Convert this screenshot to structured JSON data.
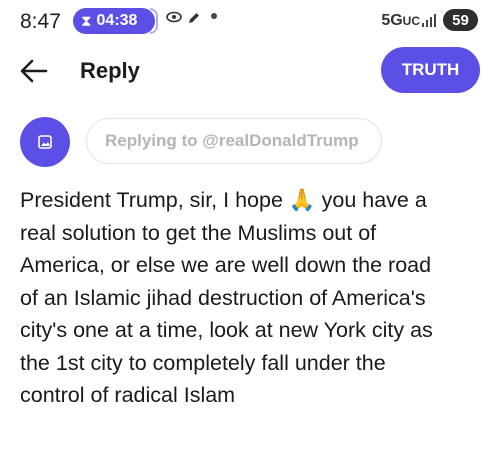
{
  "status_bar": {
    "time": "8:47",
    "timer": "04:38",
    "network": "5G",
    "network_suffix": "UC",
    "battery": "59",
    "icons": [
      "hourglass-icon",
      "eye-icon",
      "pencil-icon",
      "notification-dot-icon",
      "signal-icon",
      "battery-icon"
    ]
  },
  "header": {
    "back_icon": "back-arrow-icon",
    "title": "Reply",
    "truth_label": "TRUTH"
  },
  "reply": {
    "avatar_icon": "image-placeholder-icon",
    "replying_to": "Replying to @realDonaldTrump"
  },
  "post": {
    "lines": [
      "President Trump,  sir, I hope 🙏 you have a",
      "real solution to get the Muslims out of",
      "America,  or else we are well down the road",
      "of an Islamic jihad destruction of America's",
      "city's one at a time,  look at new York city as",
      "the 1st city to completely fall under the",
      "control of radical Islam"
    ]
  },
  "colors": {
    "accent": "#5b4fe5",
    "battery": "#2e2e2e",
    "placeholder_text": "#b4b4ba"
  }
}
